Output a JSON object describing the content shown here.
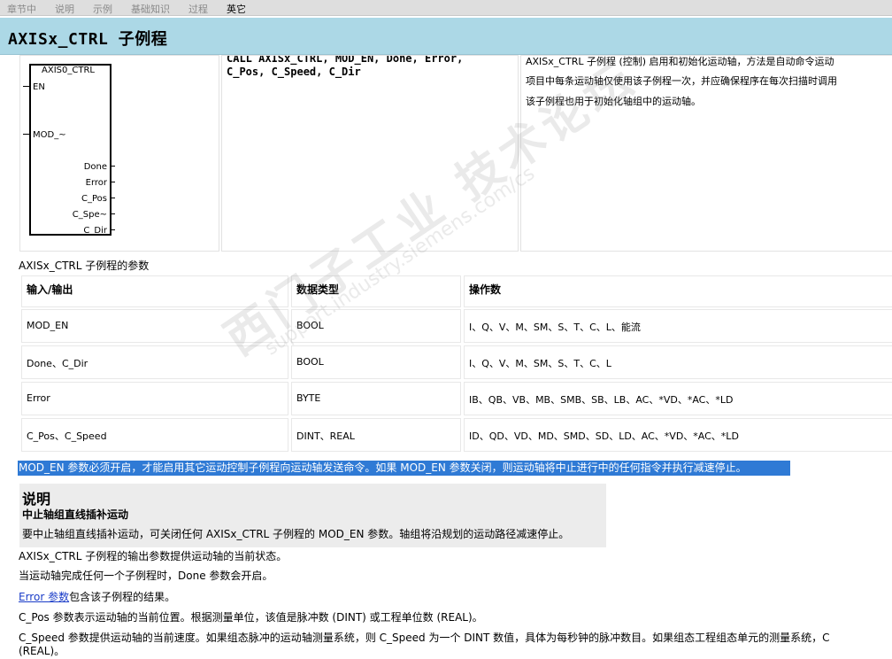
{
  "tabs": [
    {
      "label": "章节中"
    },
    {
      "label": "说明"
    },
    {
      "label": "示例"
    },
    {
      "label": "基础知识"
    },
    {
      "label": "过程"
    },
    {
      "label": "英它"
    }
  ],
  "title": "AXISx_CTRL 子例程",
  "ladder": {
    "block_name": "AXIS0_CTRL",
    "inputs": [
      "EN",
      "MOD_~"
    ],
    "outputs": [
      "Done",
      "Error",
      "C_Pos",
      "C_Spe~",
      "C_Dir"
    ]
  },
  "call_text": {
    "line1": "CALL AXISx_CTRL, MOD_EN, Done, Error,",
    "line2": "C_Pos, C_Speed, C_Dir"
  },
  "description": {
    "line1": "AXISx_CTRL 子例程 (控制) 启用和初始化运动轴，方法是自动命令运动",
    "line2": "项目中每条运动轴仅使用该子例程一次，并应确保程序在每次扫描时调用",
    "line3": "该子例程也用于初始化轴组中的运动轴。"
  },
  "params_caption": "AXISx_CTRL 子例程的参数",
  "params_table": {
    "headers": [
      "输入/输出",
      "数据类型",
      "操作数"
    ],
    "rows": [
      {
        "io": "MOD_EN",
        "type": "BOOL",
        "operands": "I、Q、V、M、SM、S、T、C、L、能流"
      },
      {
        "io": "Done、C_Dir",
        "type": "BOOL",
        "operands": "I、Q、V、M、SM、S、T、C、L"
      },
      {
        "io": "Error",
        "type": "BYTE",
        "operands": "IB、QB、VB、MB、SMB、SB、LB、AC、*VD、*AC、*LD"
      },
      {
        "io": "C_Pos、C_Speed",
        "type": "DINT、REAL",
        "operands": "ID、QD、VD、MD、SMD、SD、LD、AC、*VD、*AC、*LD"
      }
    ]
  },
  "highlight_text": "MOD_EN 参数必须开启，才能启用其它运动控制子例程向运动轴发送命令。如果 MOD_EN 参数关闭，则运动轴将中止进行中的任何指令并执行减速停止。",
  "note": {
    "heading": "说明",
    "subheading": "中止轴组直线插补运动",
    "body": "要中止轴组直线插补运动，可关闭任何 AXISx_CTRL 子例程的 MOD_EN 参数。轴组将沿规划的运动路径减速停止。"
  },
  "paragraphs": {
    "p1": "AXISx_CTRL 子例程的输出参数提供运动轴的当前状态。",
    "p2": "当运动轴完成任何一个子例程时，Done 参数会开启。",
    "p3_link": "Error 参数",
    "p3_rest": "包含该子例程的结果。",
    "p4": "C_Pos 参数表示运动轴的当前位置。根据测量单位，该值是脉冲数 (DINT) 或工程单位数 (REAL)。",
    "p5": "C_Speed 参数提供运动轴的当前速度。如果组态脉冲的运动轴测量系统，则 C_Speed 为一个 DINT 数值，具体为每秒钟的脉冲数目。如果组态工程组态单元的测量系统，C",
    "p6": "(REAL)。"
  },
  "watermark": {
    "line1": "西门子工业  技术论坛",
    "line2": "support.industry.siemens.com/cs"
  }
}
